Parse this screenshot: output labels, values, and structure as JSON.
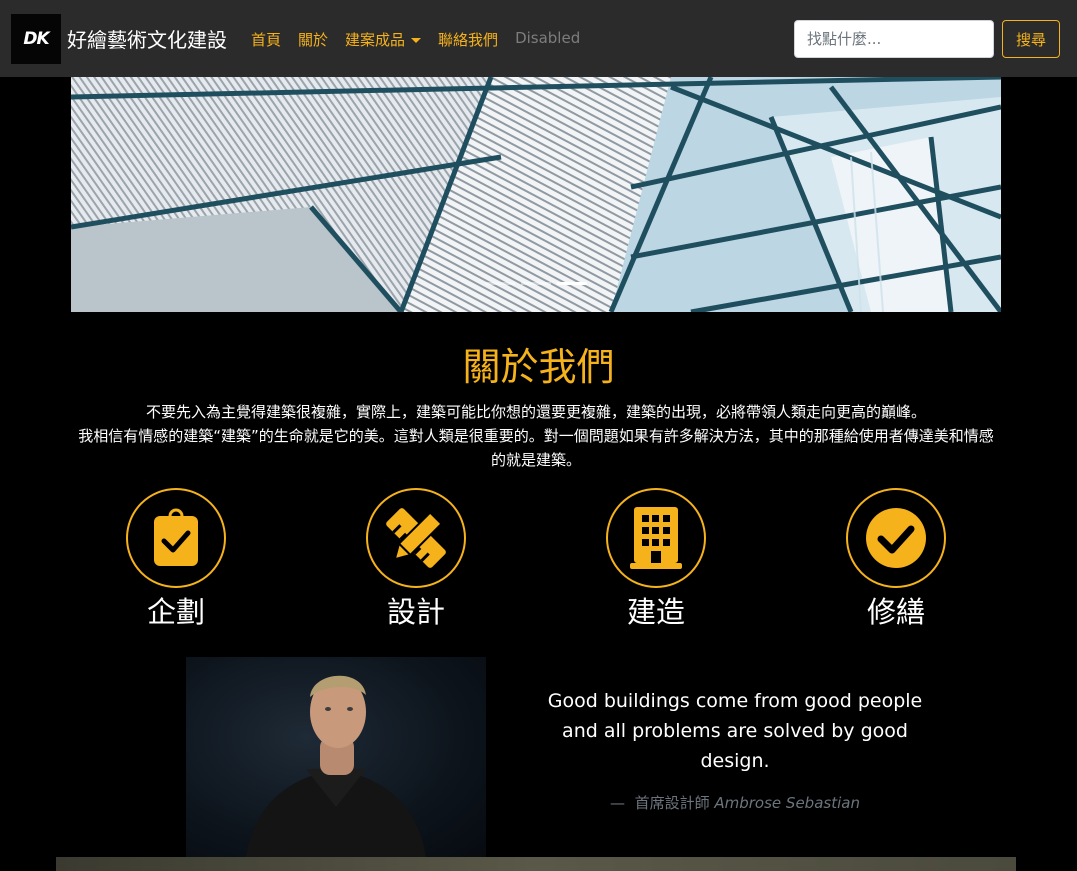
{
  "navbar": {
    "logo_text": "DK",
    "brand": "好繪藝術文化建設",
    "items": [
      {
        "label": "首頁"
      },
      {
        "label": "關於"
      },
      {
        "label": "建案成品"
      },
      {
        "label": "聯絡我們"
      },
      {
        "label": "Disabled"
      }
    ],
    "search_placeholder": "找點什麼...",
    "search_button": "搜尋"
  },
  "hero": {
    "slide_count": 3,
    "active_slide": 2
  },
  "about": {
    "title": "關於我們",
    "line1": "不要先入為主覺得建築很複雜，實際上，建築可能比你想的還要更複雜，建築的出現，必將帶領人類走向更高的巔峰。",
    "line2": "我相信有情感的建築“建築”的生命就是它的美。這對人類是很重要的。對一個問題如果有許多解決方法，其中的那種給使用者傳達美和情感的就是建築。"
  },
  "services": [
    {
      "label": "企劃",
      "icon": "clipboard-check-icon"
    },
    {
      "label": "設計",
      "icon": "pencil-ruler-icon"
    },
    {
      "label": "建造",
      "icon": "building-icon"
    },
    {
      "label": "修繕",
      "icon": "check-circle-icon"
    }
  ],
  "quote": {
    "text": "Good buildings come from good people and all problems are solved by good design.",
    "dash": "—",
    "role": "首席設計師",
    "author": "Ambrose Sebastian"
  },
  "colors": {
    "accent": "#f5b21b",
    "navbar_bg": "#2b2b2b",
    "page_bg": "#000000",
    "muted": "#6c757d"
  }
}
